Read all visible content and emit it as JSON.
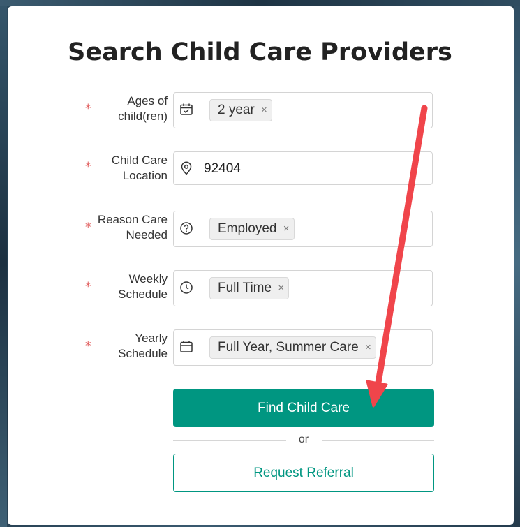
{
  "page": {
    "title": "Search Child Care Providers"
  },
  "form": {
    "required_marker": "*",
    "ages": {
      "label_line1": "Ages of",
      "label_line2": "child(ren)",
      "chips": [
        "2 year"
      ],
      "icon": "calendar-check-icon"
    },
    "location": {
      "label_line1": "Child Care",
      "label_line2": "Location",
      "value": "92404",
      "icon": "map-pin-icon"
    },
    "reason": {
      "label_line1": "Reason Care",
      "label_line2": "Needed",
      "chips": [
        "Employed"
      ],
      "icon": "question-circle-icon"
    },
    "weekly": {
      "label_line1": "Weekly",
      "label_line2": "Schedule",
      "chips": [
        "Full Time"
      ],
      "icon": "clock-icon"
    },
    "yearly": {
      "label_line1": "Yearly",
      "label_line2": "Schedule",
      "chips": [
        "Full Year, Summer Care"
      ],
      "icon": "calendar-icon"
    },
    "chip_remove": "×"
  },
  "actions": {
    "primary_label": "Find Child Care",
    "separator": "or",
    "secondary_label": "Request Referral"
  },
  "colors": {
    "accent": "#009681",
    "required": "#e05a5a",
    "annotation_arrow": "#f0454b"
  }
}
